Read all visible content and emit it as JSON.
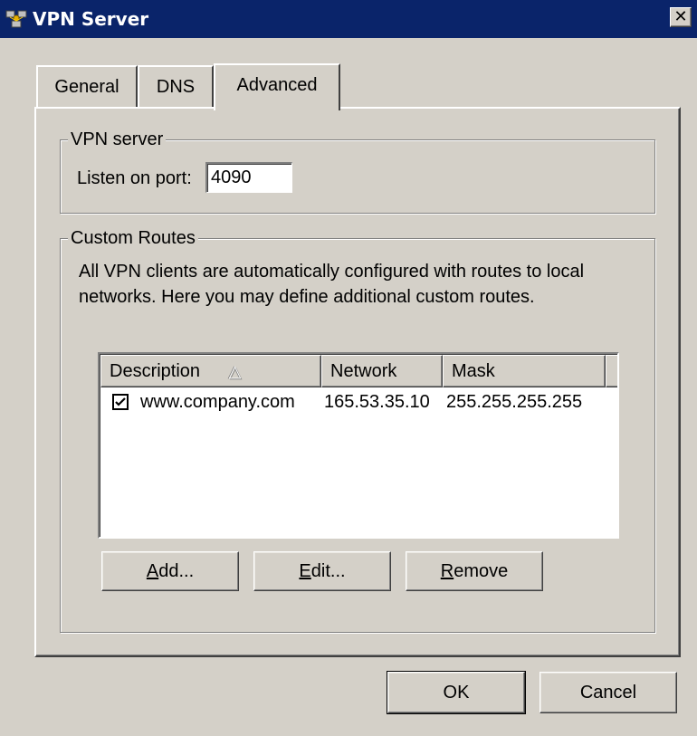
{
  "window": {
    "title": "VPN Server",
    "icon": "network-icon",
    "close_label": "✕"
  },
  "tabs": [
    {
      "label": "General"
    },
    {
      "label": "DNS"
    },
    {
      "label": "Advanced",
      "active": true
    }
  ],
  "vpn_server": {
    "group_title": "VPN server",
    "port_label": "Listen on port:",
    "port_value": "4090"
  },
  "custom_routes": {
    "group_title": "Custom Routes",
    "description_line1": "All VPN clients are automatically configured with routes to local",
    "description_line2": "networks. Here you may define additional custom routes.",
    "columns": [
      "Description",
      "Network",
      "Mask"
    ],
    "sort_indicator": "△",
    "rows": [
      {
        "checked": true,
        "description": "www.company.com",
        "network": "165.53.35.10",
        "mask": "255.255.255.255"
      }
    ],
    "buttons": {
      "add": {
        "mnemonic": "A",
        "rest": "dd..."
      },
      "edit": {
        "mnemonic": "E",
        "rest": "dit..."
      },
      "remove": {
        "mnemonic": "R",
        "rest": "emove"
      }
    }
  },
  "footer": {
    "ok_label": "OK",
    "cancel_label": "Cancel"
  }
}
